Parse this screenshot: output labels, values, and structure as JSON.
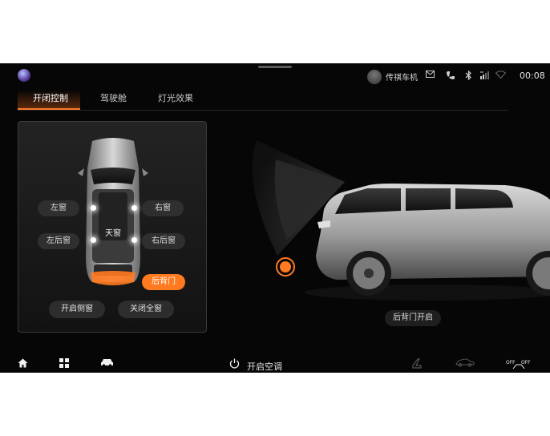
{
  "status_bar": {
    "user_name": "传祺车机",
    "time": "00:08",
    "icons": [
      "message-icon",
      "phone-mute-icon",
      "bluetooth-icon",
      "signal-icon",
      "wifi-icon"
    ]
  },
  "tabs": [
    {
      "label": "开闭控制",
      "active": true
    },
    {
      "label": "驾驶舱",
      "active": false
    },
    {
      "label": "灯光效果",
      "active": false
    }
  ],
  "panel": {
    "left_window": "左窗",
    "right_window": "右窗",
    "sunroof": "天窗",
    "left_rear_window": "左后窗",
    "right_rear_window": "右后窗",
    "tailgate": "后背门",
    "open_side_windows": "开启侧窗",
    "close_all_windows": "关闭全窗"
  },
  "vehicle_status": "后背门开启",
  "bottom_bar": {
    "hvac_label": "开启空调",
    "items": [
      "home-icon",
      "apps-icon",
      "car-icon",
      "power-icon",
      "seat-icon",
      "car-outline-icon",
      "off-off-icon"
    ]
  },
  "colors": {
    "accent": "#ff7a20",
    "background": "#060606"
  }
}
